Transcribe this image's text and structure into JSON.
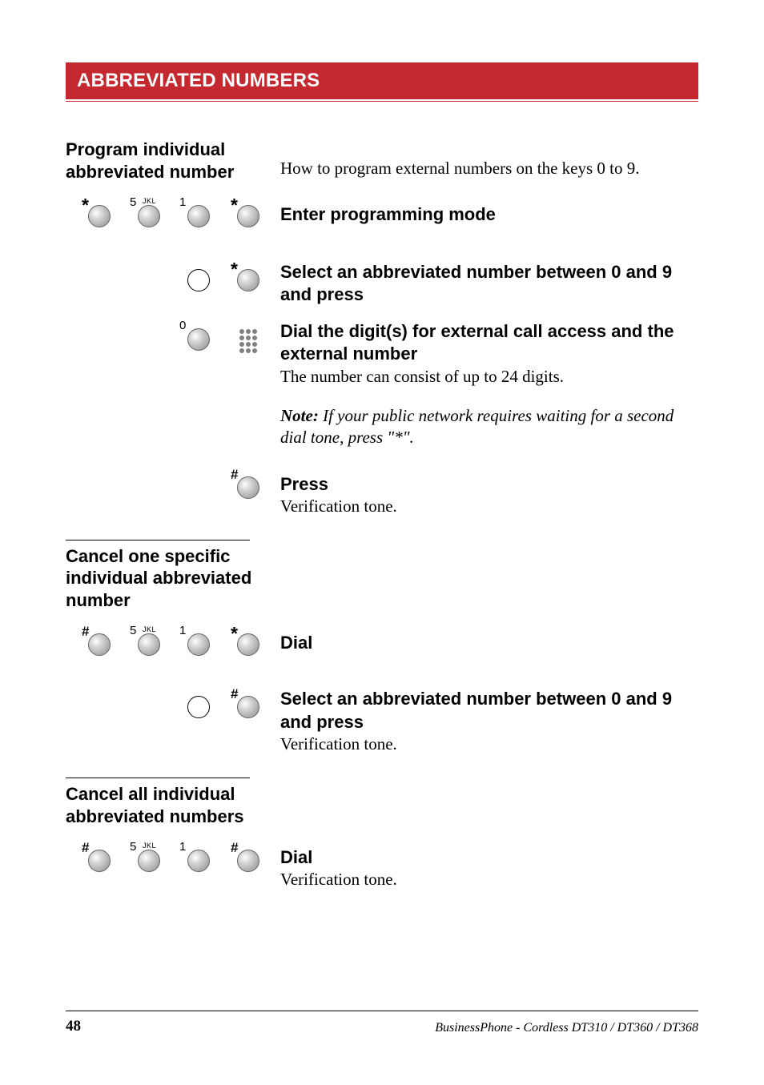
{
  "sectionTitle": "ABBREVIATED NUMBERS",
  "program": {
    "heading": "Program individual abbreviated number",
    "intro": "How to program external numbers on the keys 0 to 9.",
    "step1": "Enter programming mode",
    "step2": "Select an abbreviated number between 0 and 9 and press",
    "step3a": "Dial the digit(s) for external call access and the external number",
    "step3b": "The number can consist of up to 24 digits.",
    "note": "Note:",
    "noteBody": " If your public network requires waiting for a second dial tone, press \"*\".",
    "step4a": "Press",
    "step4b": "Verification tone."
  },
  "cancelOne": {
    "heading": "Cancel one specific individual abbreviated number",
    "step1": "Dial",
    "step2a": "Select an abbreviated number between 0 and 9 and press",
    "step2b": "Verification tone."
  },
  "cancelAll": {
    "heading": "Cancel all individual abbreviated numbers",
    "step1a": "Dial",
    "step1b": "Verification tone."
  },
  "keys": {
    "star": "*",
    "hash": "#",
    "five": "5",
    "fiveSup": "JKL",
    "one": "1",
    "zero": "0"
  },
  "footer": {
    "page": "48",
    "doc": "BusinessPhone - Cordless DT310 / DT360 / DT368"
  }
}
